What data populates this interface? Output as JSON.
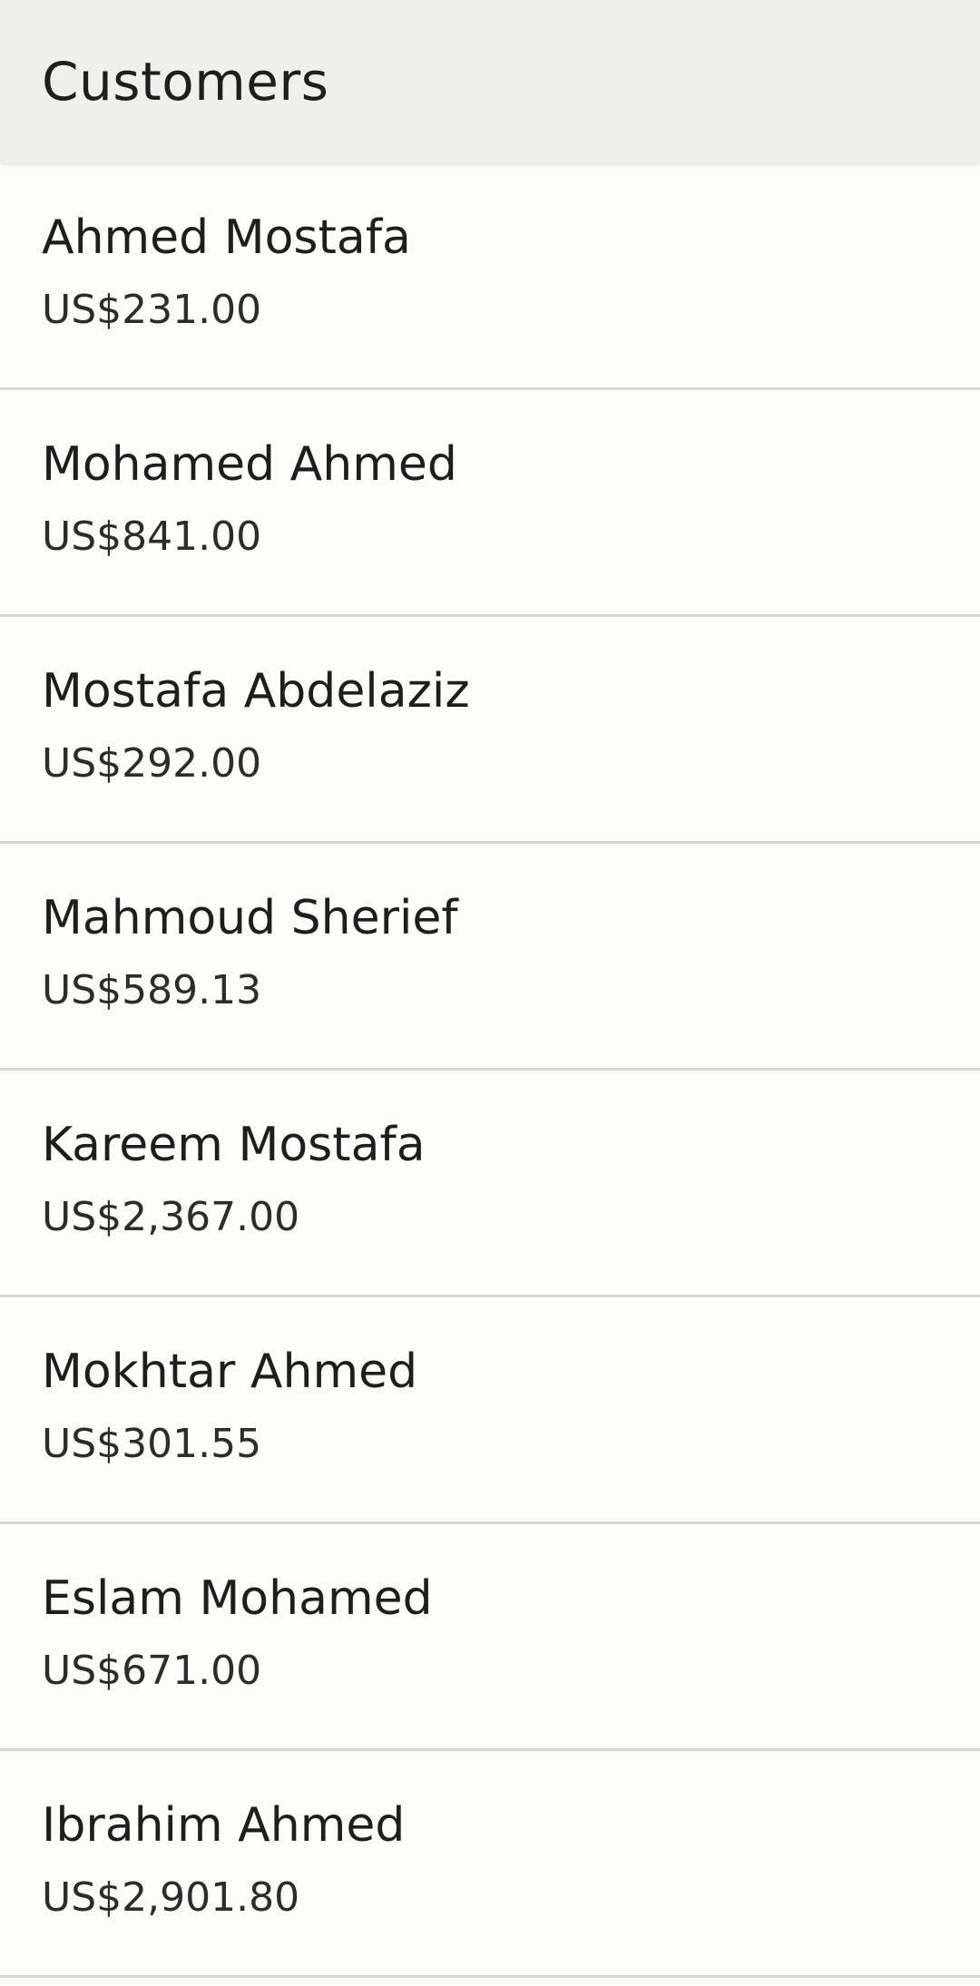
{
  "app_bar": {
    "title": "Customers"
  },
  "customers": [
    {
      "name": "Ahmed Mostafa",
      "amount": "US$231.00"
    },
    {
      "name": "Mohamed Ahmed",
      "amount": "US$841.00"
    },
    {
      "name": "Mostafa Abdelaziz",
      "amount": "US$292.00"
    },
    {
      "name": "Mahmoud Sherief",
      "amount": "US$589.13"
    },
    {
      "name": "Kareem Mostafa",
      "amount": "US$2,367.00"
    },
    {
      "name": "Mokhtar Ahmed",
      "amount": "US$301.55"
    },
    {
      "name": "Eslam Mohamed",
      "amount": "US$671.00"
    },
    {
      "name": "Ibrahim Ahmed",
      "amount": "US$2,901.80"
    }
  ],
  "colors": {
    "app_bar_background": "#eef0e9",
    "page_background": "#fdfdf7",
    "divider": "#d6d8d3",
    "text": "#1c1f1c"
  }
}
